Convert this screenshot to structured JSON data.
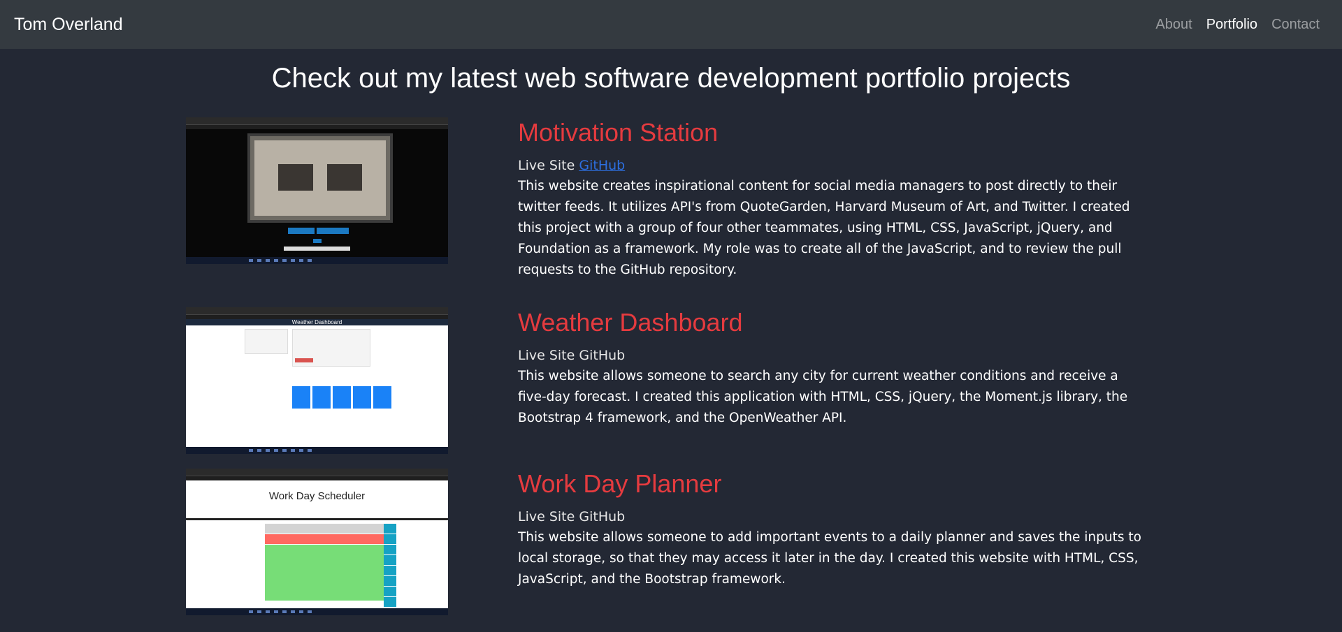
{
  "nav": {
    "brand": "Tom Overland",
    "links": [
      {
        "label": "About",
        "active": false
      },
      {
        "label": "Portfolio",
        "active": true
      },
      {
        "label": "Contact",
        "active": false
      }
    ]
  },
  "headline": "Check out my latest web software development portfolio projects",
  "projects": [
    {
      "title": "Motivation Station",
      "live_label": "Live Site",
      "github_label": "GitHub",
      "description": "This website creates inspirational content for social media managers to post directly to their twitter feeds. It utilizes API's from QuoteGarden, Harvard Museum of Art, and Twitter. I created this project with a group of four other teammates, using HTML, CSS, JavaScript, jQuery, and Foundation as a framework. My role was to create all of the JavaScript, and to review the pull requests to the GitHub repository."
    },
    {
      "title": "Weather Dashboard",
      "live_label": "Live Site",
      "github_label": "GitHub",
      "description": "This website allows someone to search any city for current weather conditions and receive a five-day forecast. I created this application with HTML, CSS, jQuery, the Moment.js library, the Bootstrap 4 framework, and the OpenWeather API.",
      "thumb_header": "Weather Dashboard"
    },
    {
      "title": "Work Day Planner",
      "live_label": "Live Site",
      "github_label": "GitHub",
      "description": "This website allows someone to add important events to a daily planner and saves the inputs to local storage, so that they may access it later in the day. I created this website with HTML, CSS, JavaScript, and the Bootstrap framework.",
      "thumb_title": "Work Day Scheduler"
    }
  ],
  "colors": {
    "background": "#232834",
    "navbar": "#343a40",
    "project_title": "#e53b3f",
    "link": "#2d6fe0"
  }
}
